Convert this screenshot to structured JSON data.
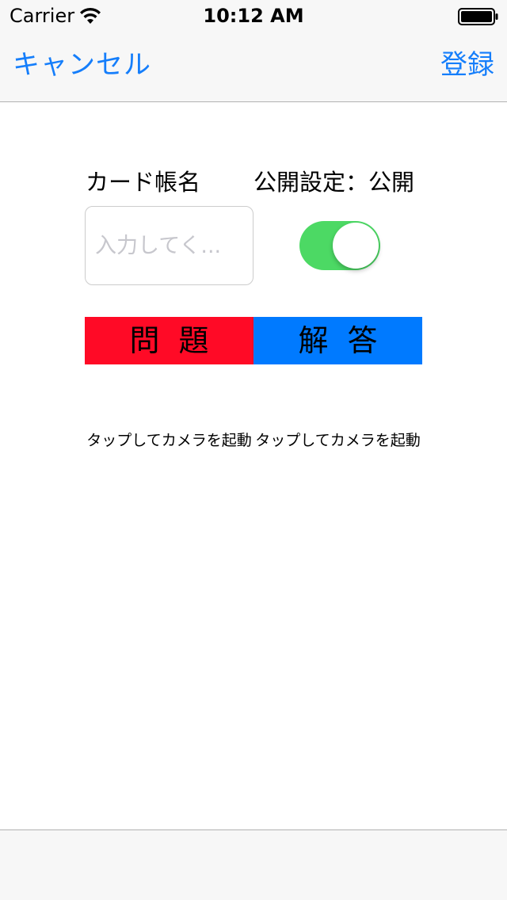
{
  "status_bar": {
    "carrier": "Carrier",
    "time": "10:12 AM",
    "wifi_icon": "wifi-icon",
    "battery_icon": "battery-full-icon"
  },
  "nav_bar": {
    "cancel_label": "キャンセル",
    "register_label": "登録"
  },
  "form": {
    "cardbook_label": "カード帳名",
    "cardbook_placeholder": "入力してく...",
    "cardbook_value": "",
    "public_label": "公開設定：公開",
    "public_on": true
  },
  "tabs": {
    "question_label": "問題",
    "answer_label": "解答"
  },
  "camera": {
    "question_hint": "タップしてカメラを起動",
    "answer_hint": "タップしてカメラを起動"
  },
  "colors": {
    "accent": "#157efb",
    "question_tab": "#ff0a26",
    "answer_tab": "#007aff",
    "toggle_on": "#4cd964"
  }
}
